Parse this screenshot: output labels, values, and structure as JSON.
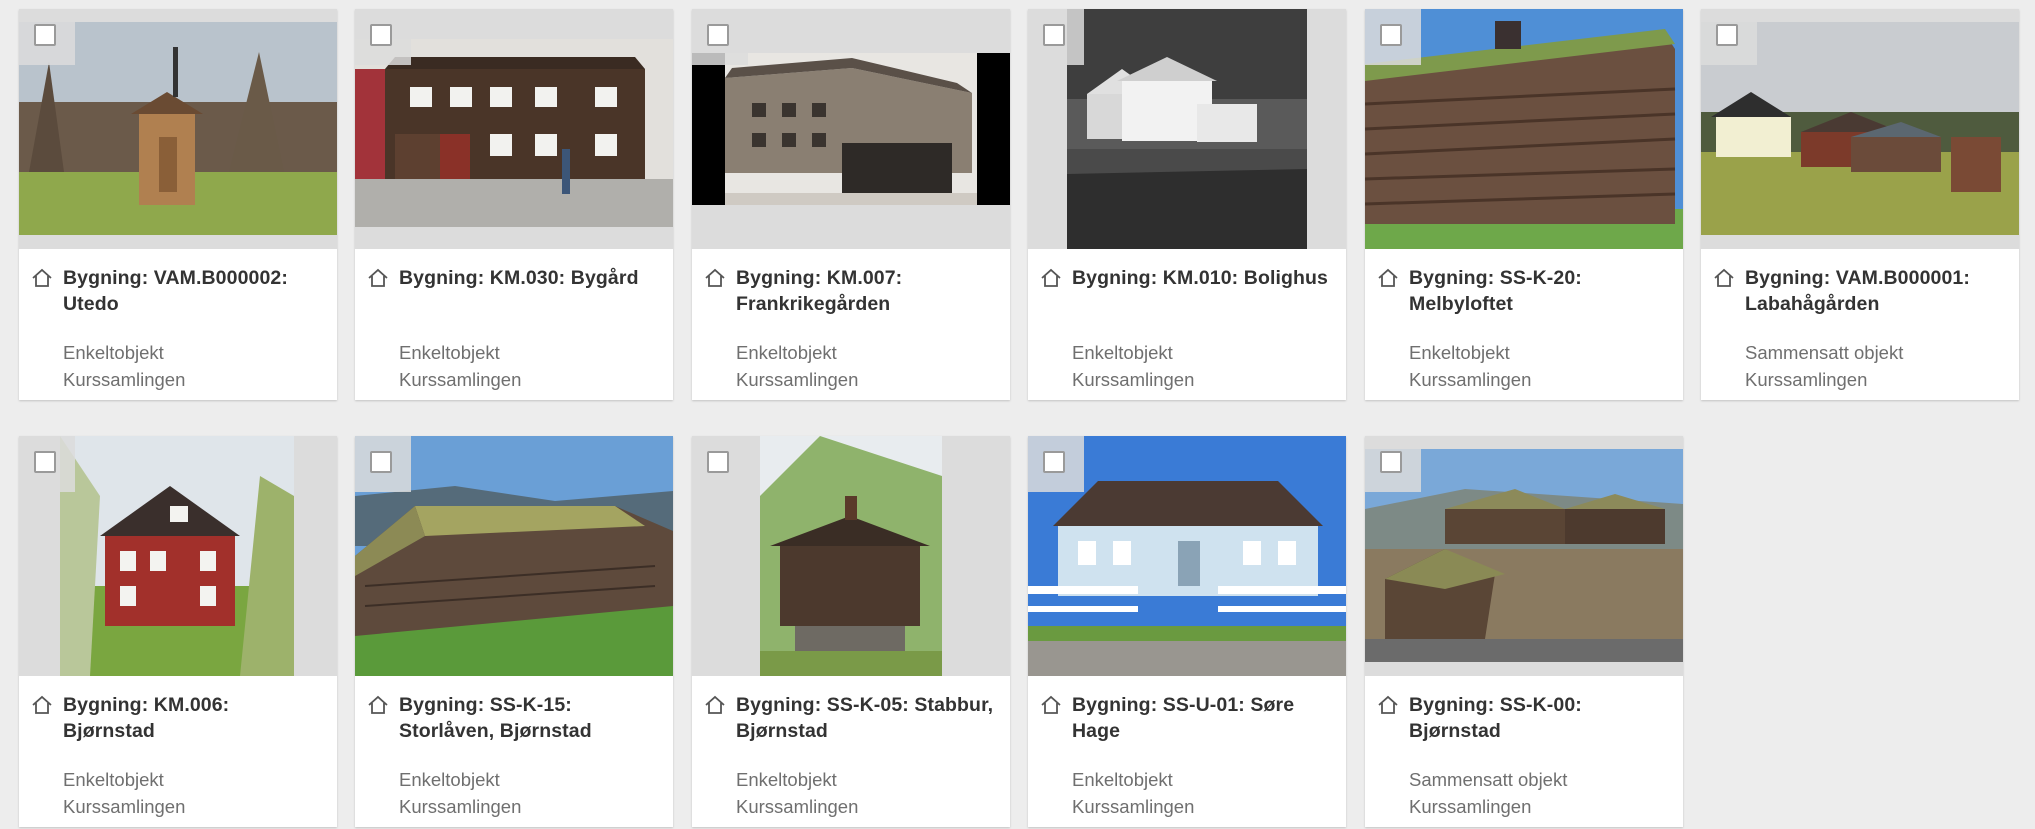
{
  "cards": [
    {
      "title": "Bygning: VAM.B000002: Utedo",
      "type": "Enkeltobjekt",
      "collection": "Kurssamlingen",
      "icon": "house-outline-icon",
      "checked": false
    },
    {
      "title": "Bygning: KM.030: Bygård",
      "type": "Enkeltobjekt",
      "collection": "Kurssamlingen",
      "icon": "house-outline-icon",
      "checked": false
    },
    {
      "title": "Bygning: KM.007: Frankrikegården",
      "type": "Enkeltobjekt",
      "collection": "Kurssamlingen",
      "icon": "house-outline-icon",
      "checked": false
    },
    {
      "title": "Bygning: KM.010: Bolighus",
      "type": "Enkeltobjekt",
      "collection": "Kurssamlingen",
      "icon": "house-outline-icon",
      "checked": false
    },
    {
      "title": "Bygning: SS-K-20: Melbyloftet",
      "type": "Enkeltobjekt",
      "collection": "Kurssamlingen",
      "icon": "house-outline-icon",
      "checked": false
    },
    {
      "title": "Bygning: VAM.B000001: Labahågården",
      "type": "Sammensatt objekt",
      "collection": "Kurssamlingen",
      "icon": "house-outline-icon",
      "checked": false
    },
    {
      "title": "Bygning: KM.006: Bjørnstad",
      "type": "Enkeltobjekt",
      "collection": "Kurssamlingen",
      "icon": "house-outline-icon",
      "checked": false
    },
    {
      "title": "Bygning: SS-K-15: Storlåven, Bjørnstad",
      "type": "Enkeltobjekt",
      "collection": "Kurssamlingen",
      "icon": "house-outline-icon",
      "checked": false
    },
    {
      "title": "Bygning: SS-K-05: Stabbur, Bjørnstad",
      "type": "Enkeltobjekt",
      "collection": "Kurssamlingen",
      "icon": "house-outline-icon",
      "checked": false
    },
    {
      "title": "Bygning: SS-U-01: Søre Hage",
      "type": "Enkeltobjekt",
      "collection": "Kurssamlingen",
      "icon": "house-outline-icon",
      "checked": false
    },
    {
      "title": "Bygning: SS-K-00: Bjørnstad",
      "type": "Sammensatt objekt",
      "collection": "Kurssamlingen",
      "icon": "house-outline-icon",
      "checked": false
    }
  ],
  "colors": {
    "page_background": "#ededed",
    "card_background": "#ffffff",
    "title_text": "#333333",
    "meta_text": "#6f6f6f"
  }
}
